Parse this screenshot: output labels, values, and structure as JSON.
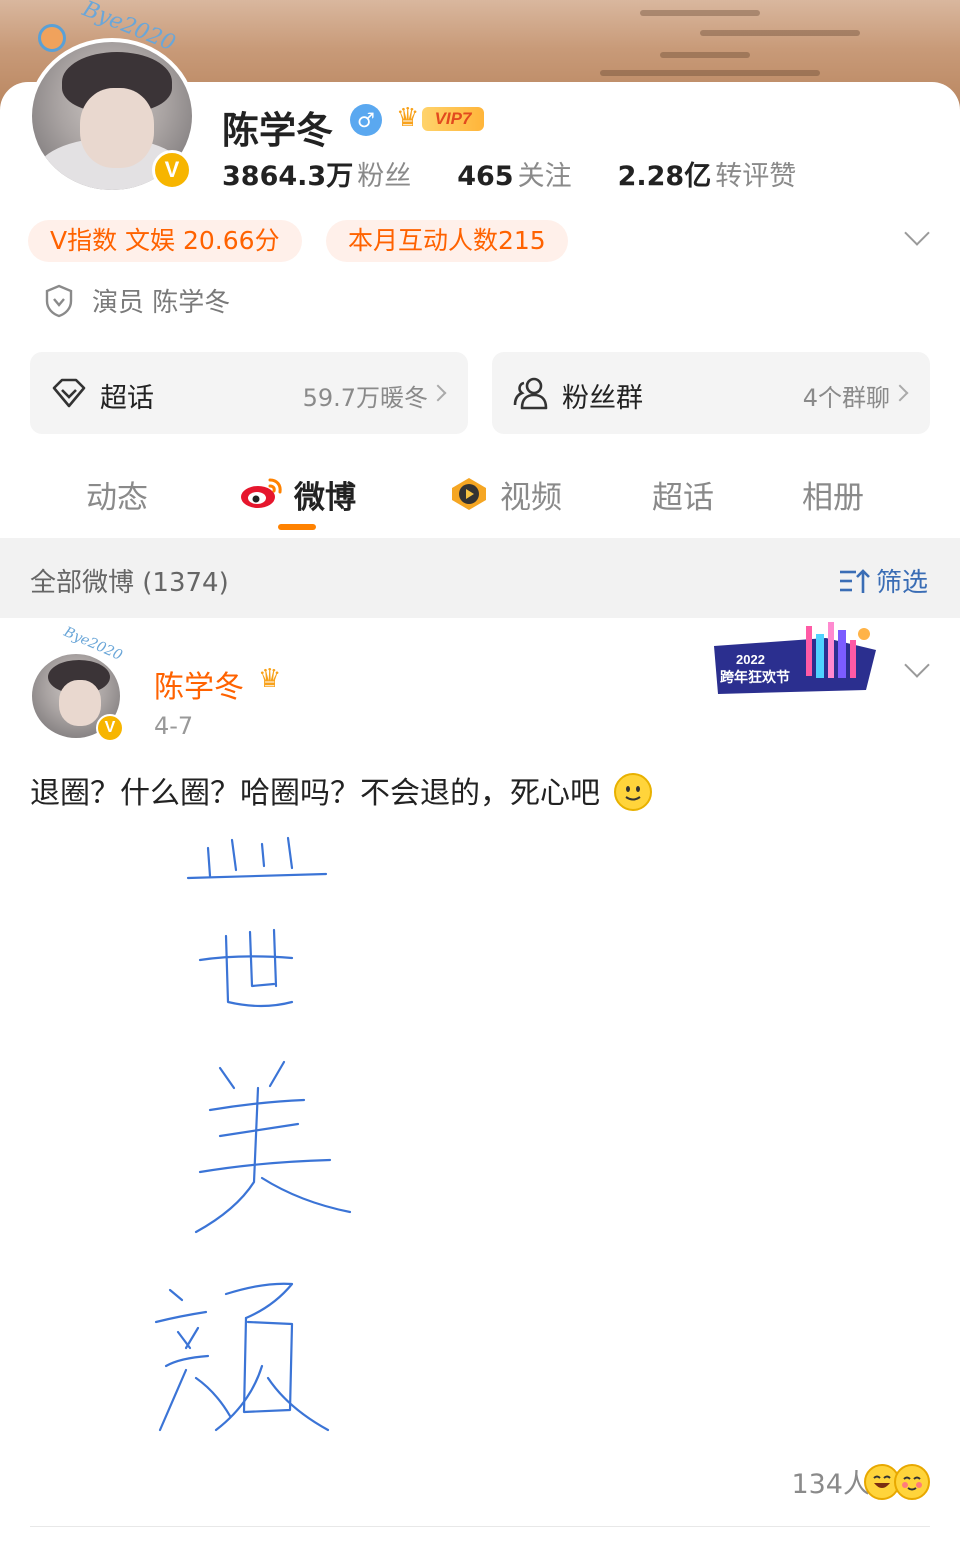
{
  "profile": {
    "name": "陈学冬",
    "gender_icon": "male-icon",
    "vip_label": "VIP7",
    "avatar_frame_text": "Bye2020",
    "verified_badge": "V",
    "stats": [
      {
        "num": "3864.3万",
        "label": "粉丝"
      },
      {
        "num": "465",
        "label": "关注"
      },
      {
        "num": "2.28亿",
        "label": "转评赞"
      }
    ],
    "pills": [
      "V指数 文娱 20.66分",
      "本月互动人数215"
    ],
    "verification": "演员 陈学冬"
  },
  "cards": {
    "supertopic": {
      "title": "超话",
      "detail": "59.7万暖冬"
    },
    "fangroup": {
      "title": "粉丝群",
      "detail": "4个群聊"
    }
  },
  "tabs": [
    "动态",
    "微博",
    "视频",
    "超话",
    "相册"
  ],
  "active_tab": "微博",
  "filter": {
    "all_label": "全部微博 (1374)",
    "filter_label": "筛选"
  },
  "post": {
    "author": "陈学冬",
    "avatar_frame_text": "Bye2020",
    "verified_badge": "V",
    "time": "4-7",
    "promo_text": "2022 跨年狂欢节",
    "text": "退圈？什么圈？哈圈吗？不会退的，死心吧",
    "image_description_label": "盛世美颜",
    "likes": "134人"
  },
  "colors": {
    "accent": "#ff6200",
    "tab_underline": "#ff8200",
    "link": "#3a6db5",
    "badge": "#f7b500"
  }
}
